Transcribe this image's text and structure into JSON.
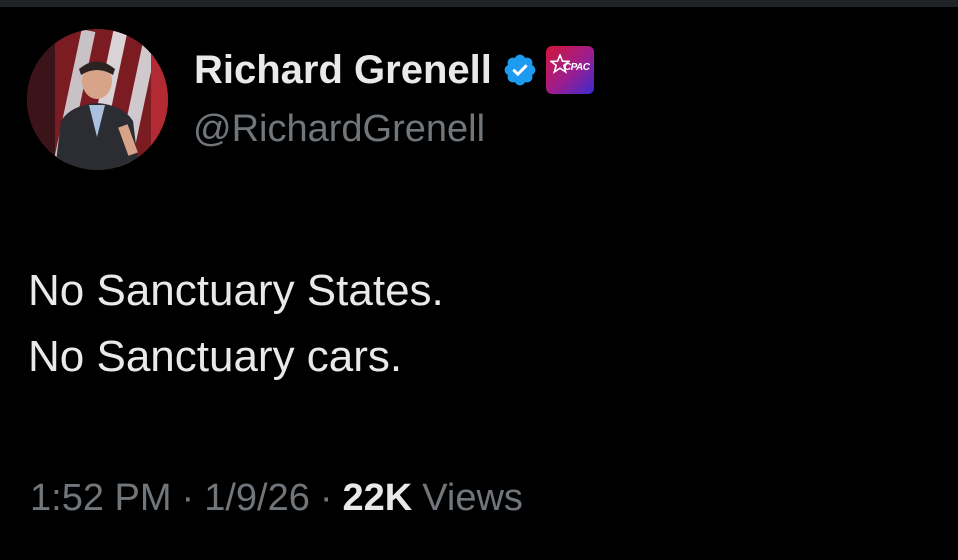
{
  "tweet": {
    "author": {
      "display_name": "Richard Grenell",
      "handle": "@RichardGrenell",
      "avatar_icon": "profile-photo-avatar",
      "verified_icon": "verified-badge-icon",
      "affiliate_icon": "cpac-affiliate-badge",
      "affiliate_label": "CPAC"
    },
    "text_lines": [
      "No Sanctuary States.",
      "No Sanctuary cars."
    ],
    "meta": {
      "time": "1:52 PM",
      "separator": "·",
      "date": "1/9/26",
      "views_count": "22K",
      "views_label": "Views"
    }
  },
  "colors": {
    "background": "#000000",
    "primary_text": "#e7e9ea",
    "secondary_text": "#71767b",
    "verified_blue": "#1d9bf0"
  }
}
